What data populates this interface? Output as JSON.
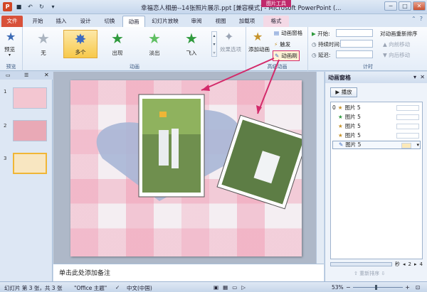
{
  "window": {
    "title": "幸福恋人相册--14张照片展示.ppt [兼容模式] - Microsoft PowerPoint (...",
    "context_tab_group": "图片工具",
    "minimize": "─",
    "maximize": "□",
    "close": "✕"
  },
  "tabs": [
    "文件",
    "开始",
    "插入",
    "设计",
    "切换",
    "动画",
    "幻灯片放映",
    "审阅",
    "视图",
    "加载项",
    "格式"
  ],
  "ribbon": {
    "preview_label": "预览",
    "preview_group": "预览",
    "gallery": [
      {
        "label": "无"
      },
      {
        "label": "多个"
      },
      {
        "label": "出现"
      },
      {
        "label": "淡出"
      },
      {
        "label": "飞入"
      }
    ],
    "effect_options": "效果选项",
    "animation_group": "动画",
    "add_animation": "添加动画",
    "animation_pane": "动画窗格",
    "trigger": "触发",
    "animation_painter": "动画刷",
    "advanced_group": "高级动画",
    "start_label": "开始:",
    "duration_label": "持续时间:",
    "delay_label": "延迟:",
    "reorder_title": "对动画重新排序",
    "move_earlier": "向前移动",
    "move_later": "向后移动",
    "timing_group": "计时"
  },
  "slides": [
    {
      "num": "1"
    },
    {
      "num": "2"
    },
    {
      "num": "3"
    }
  ],
  "notes_placeholder": "单击此处添加备注",
  "task_pane": {
    "title": "动画窗格",
    "play": "播放",
    "items": [
      {
        "num": "0",
        "name": "图片 5"
      },
      {
        "num": "",
        "name": "图片 5"
      },
      {
        "num": "",
        "name": "图片 5"
      },
      {
        "num": "",
        "name": "图片 5"
      },
      {
        "num": "",
        "name": "图片 5"
      }
    ],
    "seconds_label": "秒",
    "scale_start": "2",
    "scale_end": "4",
    "reorder_label": "重新排序"
  },
  "status": {
    "slide_info": "幻灯片 第 3 张，共 3 张",
    "theme": "\"Office 主题\"",
    "language": "中文(中国)",
    "zoom": "53%"
  }
}
